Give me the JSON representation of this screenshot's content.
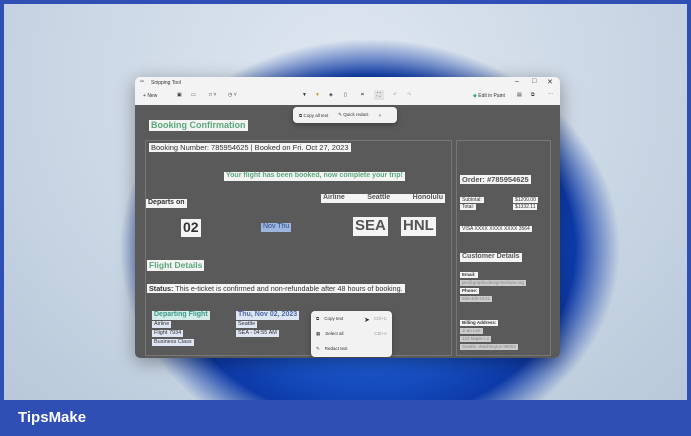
{
  "window": {
    "title": "Snipping Tool",
    "new_label": "New",
    "edit_in_paint": "Edit in Paint"
  },
  "text_actions": {
    "copy_all": "Copy all text",
    "quick_redact": "Quick redact"
  },
  "doc": {
    "heading": "Booking Confirmation",
    "booking_number": "Booking Number: 785954625 | Booked on Fri. Oct 27, 2023",
    "banner": "Your flight has been booked, now complete your trip!",
    "departs_on": "Departs on",
    "day": "02",
    "month_day": "Nov Thu",
    "route_labels": [
      "Airline",
      "Seattle",
      "Honolulu"
    ],
    "from_code": "SEA",
    "to_code": "HNL",
    "flight_details": "Flight Details",
    "status_label": "Status:",
    "status_text": "This e-ticket is confirmed and non-refundable after 48 hours of booking.",
    "departing_flight": "Departing Flight",
    "flight_lines": [
      "Airline",
      "Flight 7934",
      "Business Class"
    ],
    "date": "Thu, Nov 02, 2023",
    "date_lines": [
      "Seattle",
      "SEA - 04:55 AM"
    ],
    "order": "Order: #785954625",
    "subtotal_label": "Subtotal:",
    "subtotal": "$1200.00",
    "total_label": "Total:",
    "total": "$1332.11",
    "card": "VISA XXXX XXXX XXXX 3564",
    "customer_details": "Customer Details",
    "email_label": "Email:",
    "email": "jan@graphicdesigninstitute.org",
    "phone_label": "Phone:",
    "phone": "555-405-0131",
    "billing_label": "Billing Address:",
    "billing_lines": [
      "Ji-an Lee",
      "123 Maple Ln",
      "Seattle, Washington 98052"
    ]
  },
  "context_menu": [
    {
      "label": "Copy text",
      "shortcut": "Ctrl+C"
    },
    {
      "label": "Select all",
      "shortcut": "Ctrl+A"
    },
    {
      "label": "Redact text",
      "shortcut": ""
    }
  ],
  "footer": {
    "brand": "TipsMake"
  }
}
